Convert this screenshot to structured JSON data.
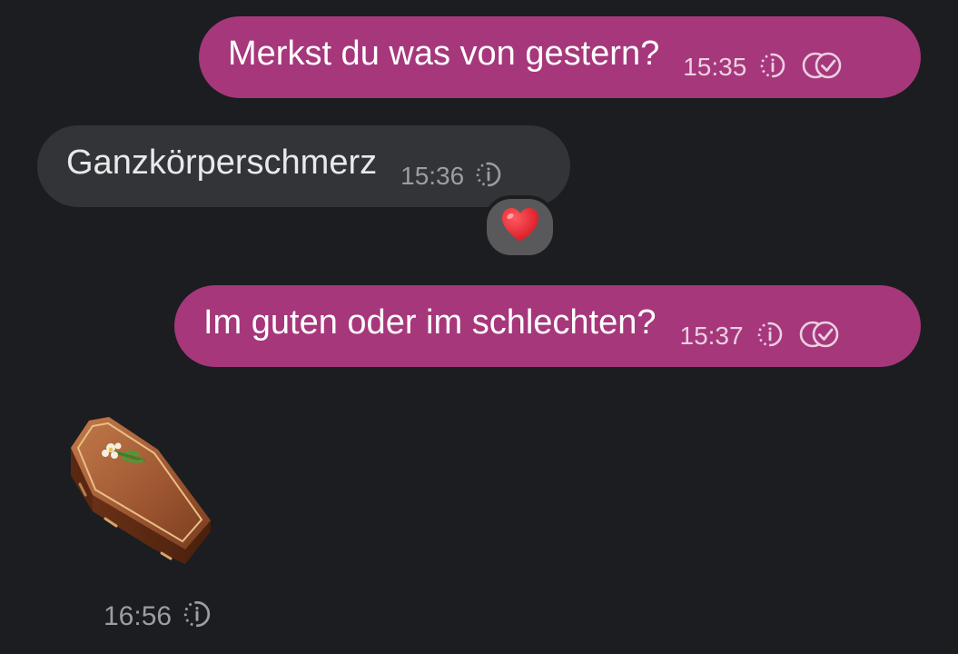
{
  "colors": {
    "background": "#1c1d21",
    "outgoing_bubble": "#a6377b",
    "incoming_bubble": "#333438",
    "reaction_bubble": "#59595c",
    "heart": "#e0202e"
  },
  "messages": [
    {
      "direction": "outgoing",
      "text": "Merkst du was von gestern?",
      "time": "15:35",
      "icons": [
        "timer-icon",
        "double-check-icon"
      ]
    },
    {
      "direction": "incoming",
      "text": "Ganzkörperschmerz",
      "time": "15:36",
      "icons": [
        "timer-icon"
      ],
      "reaction": "heart-emoji"
    },
    {
      "direction": "outgoing",
      "text": "Im guten oder im schlechten?",
      "time": "15:37",
      "icons": [
        "timer-icon",
        "double-check-icon"
      ]
    },
    {
      "direction": "incoming",
      "sticker": "coffin-emoji",
      "time": "16:56",
      "icons": [
        "timer-icon"
      ]
    }
  ]
}
